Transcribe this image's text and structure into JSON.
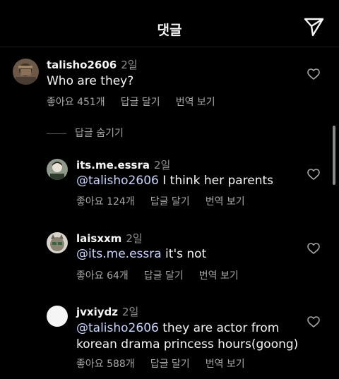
{
  "header": {
    "title": "댓글"
  },
  "comments": [
    {
      "username": "talisho2606",
      "time": "2일",
      "mention": "",
      "text": "Who are they?",
      "likes": "좋아요 451개",
      "reply": "답글 달기",
      "translate": "번역 보기"
    },
    {
      "username": "its.me.essra",
      "time": "2일",
      "mention": "@talisho2606",
      "text": " I think her parents",
      "likes": "좋아요 124개",
      "reply": "답글 달기",
      "translate": "번역 보기"
    },
    {
      "username": "laisxxm",
      "time": "2일",
      "mention": "@its.me.essra",
      "text": " it's not",
      "likes": "좋아요 64개",
      "reply": "답글 달기",
      "translate": "번역 보기"
    },
    {
      "username": "jvxiydz",
      "time": "2일",
      "mention": "@talisho2606",
      "text": " they are actor from",
      "text_line2": "korean drama princess hours(goong)",
      "likes": "좋아요 588개",
      "reply": "답글 달기",
      "translate": "번역 보기"
    }
  ],
  "hide_replies": "답글 숨기기",
  "colors": {
    "background": "#000000",
    "text": "#f5f5f5",
    "secondary": "#a8a8a8",
    "mention": "#c8d6ff"
  },
  "icons": {
    "send": "send-icon",
    "like": "heart-icon"
  }
}
